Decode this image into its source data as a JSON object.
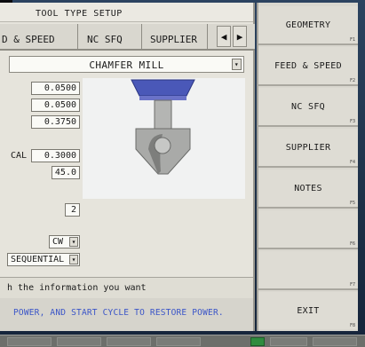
{
  "window": {
    "title": "TOOL TYPE SETUP"
  },
  "tabs": [
    {
      "label": "D & SPEED"
    },
    {
      "label": "NC SFQ"
    },
    {
      "label": "SUPPLIER"
    }
  ],
  "tab_arrows": {
    "left": "◀",
    "right": "▶"
  },
  "tool_type": {
    "value": "CHAMFER MILL"
  },
  "fields": {
    "v1": "0.0500",
    "v2": "0.0500",
    "v3": "0.3750",
    "cal_label": "CAL",
    "v4": "0.3000",
    "v5": "45.0",
    "v6": "2"
  },
  "rotation": {
    "value": "CW"
  },
  "mode": {
    "value": "SEQUENTIAL"
  },
  "info_text": "h the information you want",
  "status_text": "POWER, AND START CYCLE TO RESTORE POWER.",
  "softkeys": [
    {
      "label": "GEOMETRY",
      "fn": "F1"
    },
    {
      "label": "FEED & SPEED",
      "fn": "F2"
    },
    {
      "label": "NC SFQ",
      "fn": "F3"
    },
    {
      "label": "SUPPLIER",
      "fn": "F4"
    },
    {
      "label": "NOTES",
      "fn": "F5"
    },
    {
      "label": "",
      "fn": "F6"
    },
    {
      "label": "",
      "fn": "F7"
    },
    {
      "label": "EXIT",
      "fn": "F8"
    }
  ],
  "colors": {
    "tool_holder": "#4a58b8",
    "tool_body": "#a9aaa8",
    "status_text": "#3b55c8"
  }
}
